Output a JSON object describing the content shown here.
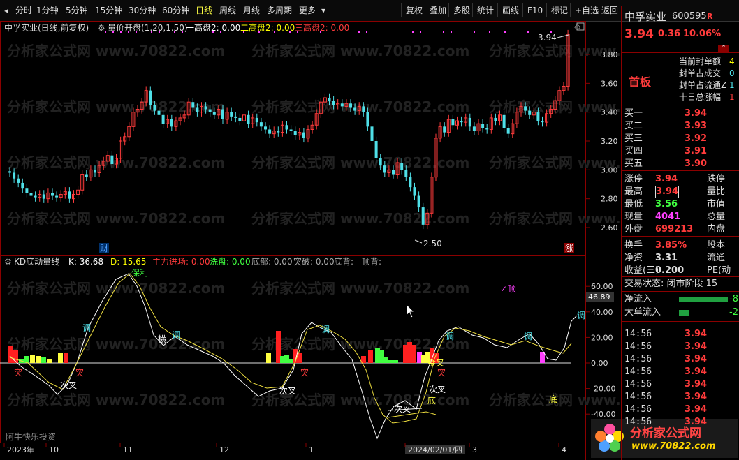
{
  "toolbar": {
    "periods": [
      "分时",
      "1分钟",
      "5分钟",
      "15分钟",
      "30分钟",
      "60分钟",
      "日线",
      "周线",
      "月线",
      "多周期",
      "更多"
    ],
    "active_period": "日线",
    "actions": [
      "复权",
      "叠加",
      "多股",
      "统计",
      "画线",
      "F10",
      "标记",
      "+自选",
      "返回"
    ]
  },
  "price_panel": {
    "title": "中孚实业(日线,前复权)",
    "indicator": "量价开盘(1.20,1.50)",
    "line1": "一高盘2: 0.00",
    "line2": "二高盘2: 0.00",
    "line3": "三高盘2: 0.00",
    "high_label": "3.94",
    "low_label": "2.50",
    "badge_cai": "财",
    "badge_zhang": "涨",
    "y_ticks": [
      "3.80",
      "3.60",
      "3.40",
      "3.20",
      "3.00",
      "2.80",
      "2.60"
    ]
  },
  "kd_panel": {
    "title": "KD底动量线",
    "k": "K: 36.68",
    "d": "D: 15.65",
    "zhuli": "主力进场: 0.00",
    "xipan": "洗盘: 0.00",
    "dibu": "底部: 0.00",
    "tupo": "突破: 0.00",
    "dibei": "底背: -",
    "dingbei": "顶背: -",
    "current_value": "46.89",
    "y_ticks": [
      "60.00",
      "40.00",
      "20.00",
      "0.00",
      "-20.00",
      "-40.00"
    ],
    "annotations": {
      "baoli": "保利",
      "ding": "顶",
      "tiao": "调",
      "heng": "横",
      "tu": "突",
      "cicha": "次叉",
      "jincha": "金叉",
      "di": "底"
    }
  },
  "x_axis": {
    "labels": [
      "2023年",
      "10",
      "11",
      "12",
      "1",
      "2024/02/01/四",
      "3",
      "4"
    ]
  },
  "watermark": "分析家公式网 www.70822.com",
  "footer_left": "阿牛快乐投资",
  "logo": {
    "text": "分析家公式网",
    "url": "www.70822.com"
  },
  "sidebar": {
    "name": "中孚实业",
    "code": "600595",
    "flag": "R",
    "price": "3.94",
    "change": "0.36",
    "pct": "10.06%",
    "badge": "首板",
    "seal_info": [
      "当前封单额",
      "封单占成交",
      "封单占流通Z",
      "十日总涨幅"
    ],
    "seal_vals": [
      "4",
      "0",
      "1",
      "1"
    ],
    "bids": [
      {
        "label": "买一",
        "price": "3.94"
      },
      {
        "label": "买二",
        "price": "3.93"
      },
      {
        "label": "买三",
        "price": "3.92"
      },
      {
        "label": "买四",
        "price": "3.91"
      },
      {
        "label": "买五",
        "price": "3.90"
      }
    ],
    "stats": [
      {
        "label": "涨停",
        "value": "3.94",
        "label2": "跌停"
      },
      {
        "label": "最高",
        "value": "3.94",
        "label2": "量比"
      },
      {
        "label": "最低",
        "value": "3.56",
        "label2": "市值"
      },
      {
        "label": "现量",
        "value": "4041",
        "label2": "总量"
      },
      {
        "label": "外盘",
        "value": "699213",
        "label2": "内盘"
      }
    ],
    "stats2": [
      {
        "label": "换手",
        "value": "3.85%",
        "label2": "股本"
      },
      {
        "label": "净资",
        "value": "3.31",
        "label2": "流通"
      },
      {
        "label": "收益(三)",
        "value": "0.200",
        "label2": "PE(动"
      }
    ],
    "trade_state": "交易状态: 闭市阶段 15",
    "flow": [
      {
        "label": "净流入",
        "value": "-8"
      },
      {
        "label": "大单流入",
        "value": "-2"
      }
    ],
    "ticks": [
      {
        "time": "14:56",
        "price": "3.94"
      },
      {
        "time": "14:56",
        "price": "3.94"
      },
      {
        "time": "14:56",
        "price": "3.94"
      },
      {
        "time": "14:56",
        "price": "3.94"
      },
      {
        "time": "14:56",
        "price": "3.94"
      },
      {
        "time": "14:56",
        "price": "3.94"
      },
      {
        "time": "14:56",
        "price": "3.94"
      },
      {
        "time": "14:56",
        "price": "3.94"
      }
    ]
  },
  "colors": {
    "up": "#ff3b3b",
    "down": "#4fe0e8",
    "bg": "#000000",
    "accent": "#ffff40",
    "magenta": "#ff40ff"
  }
}
